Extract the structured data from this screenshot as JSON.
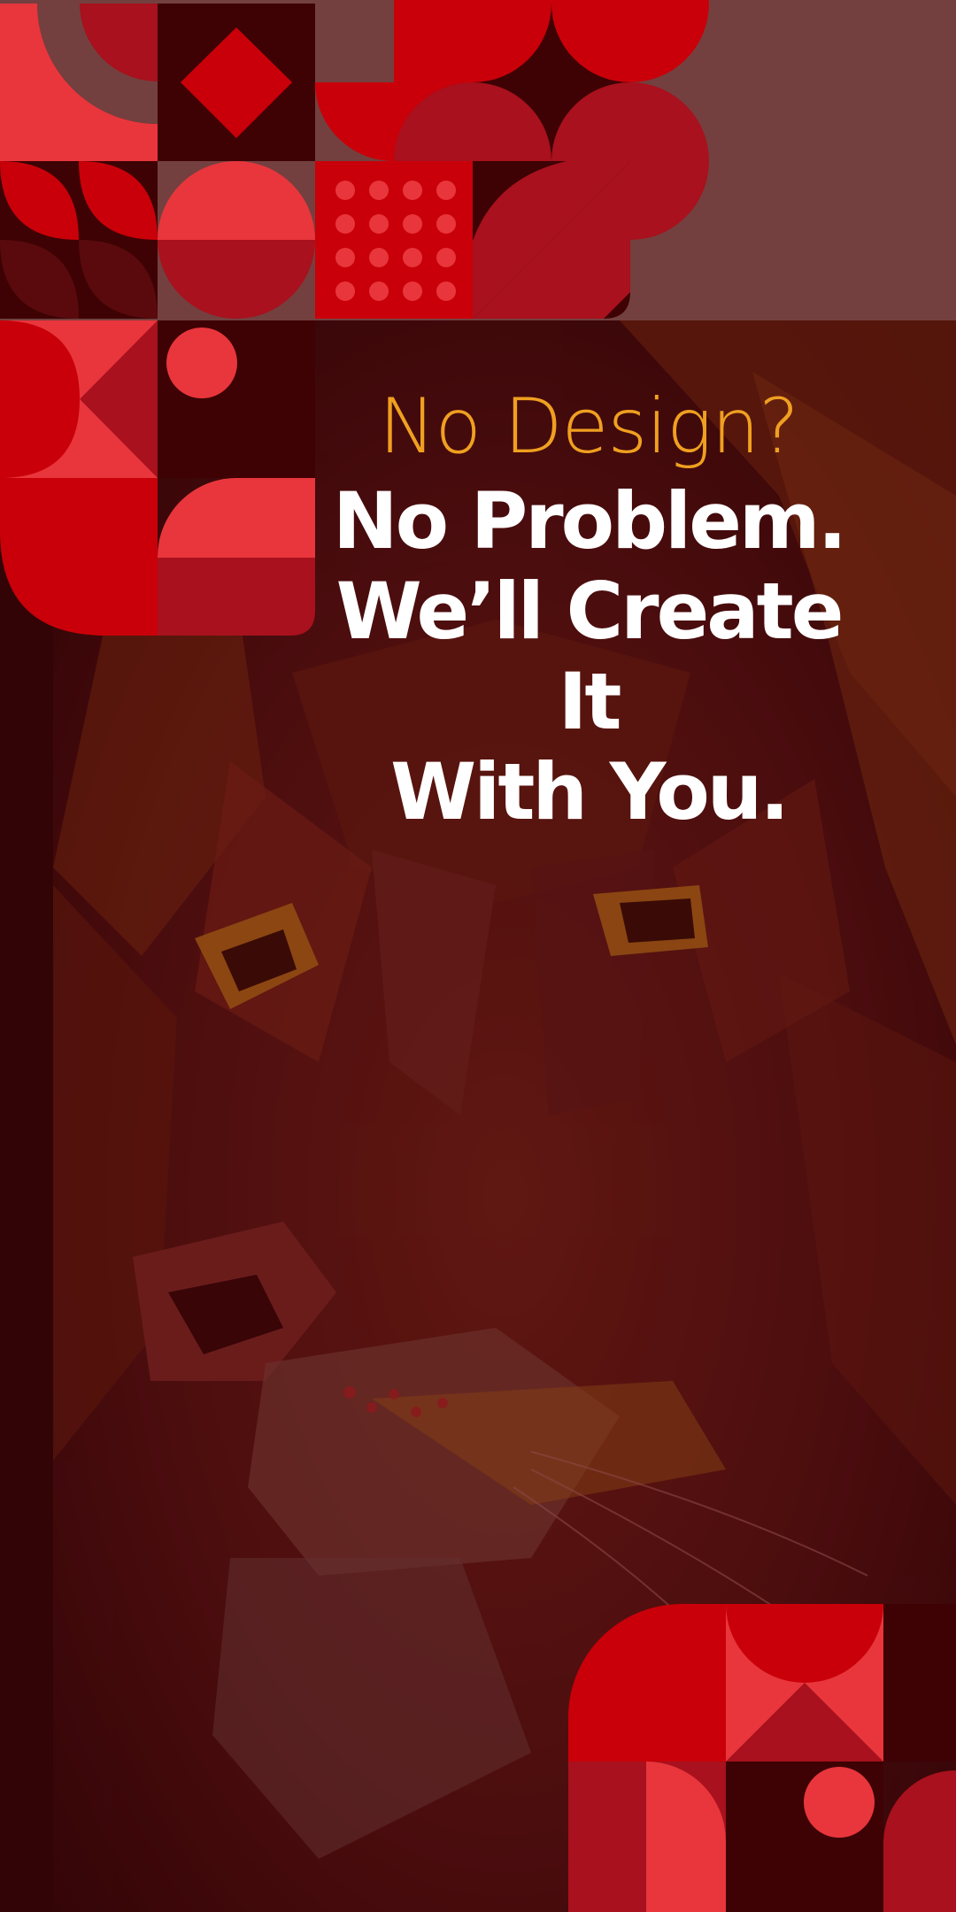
{
  "headline": {
    "accent_line": "No Design?",
    "main_lines": [
      "No Problem.",
      "We’ll Create",
      "It",
      "With You."
    ]
  },
  "colors": {
    "background": "#2e0406",
    "top_band": "#73403f",
    "accent_text": "#f0a020",
    "main_text": "#ffffff",
    "red_bright": "#e8363c",
    "red_mid": "#c90009",
    "red_dark": "#a8111d",
    "maroon": "#3e0204"
  },
  "artwork": {
    "subject": "lion-face-polygon-art",
    "pattern": "geometric-tile-mosaic"
  }
}
